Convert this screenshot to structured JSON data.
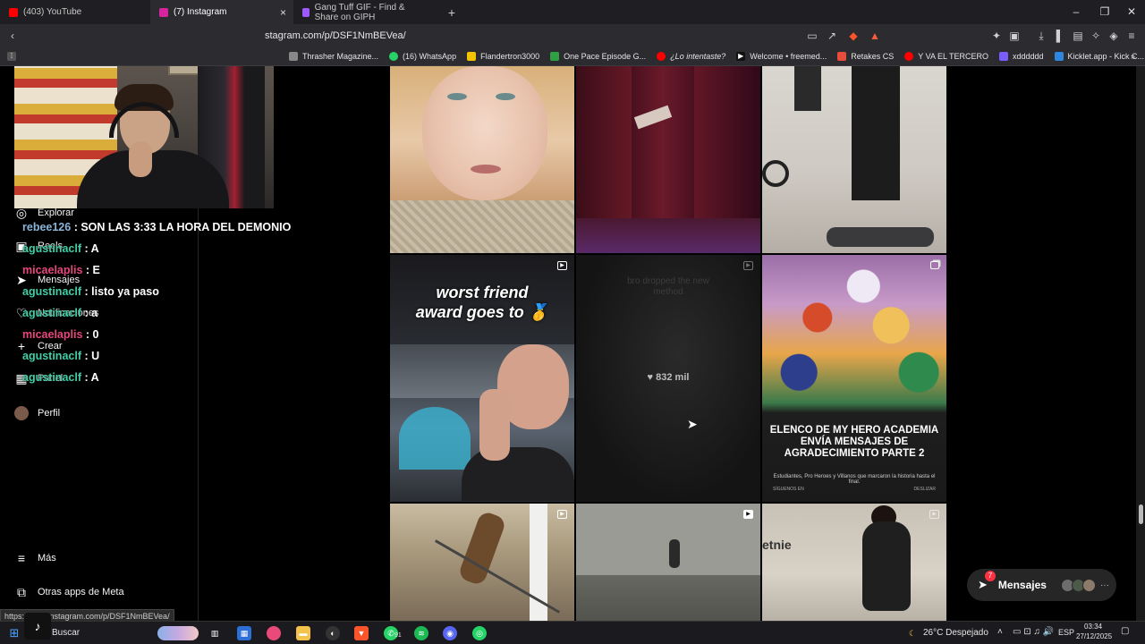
{
  "tabs": [
    {
      "title": "(403) YouTube",
      "color": "#ff0000"
    },
    {
      "title": "(7) Instagram",
      "color": "#d6249f"
    },
    {
      "title": "Gang Tuff GIF - Find & Share on GIPH",
      "color": "#9b59ff"
    }
  ],
  "address": {
    "url": "stagram.com/p/DSF1NmBEVea/"
  },
  "bookmarks": [
    {
      "label": "Thrasher Magazine...",
      "color": "#fff"
    },
    {
      "label": "(16) WhatsApp",
      "color": "#25d366"
    },
    {
      "label": "Flandertron3000",
      "color": "#f3c300"
    },
    {
      "label": "One Pace Episode G...",
      "color": "#2ea043"
    },
    {
      "label": "¿Lo intentaste?",
      "color": "#ff0000"
    },
    {
      "label": "Welcome • freemed...",
      "color": "#111"
    },
    {
      "label": "Retakes CS",
      "color": "#e74c3c"
    },
    {
      "label": "Y VA EL TERCERO",
      "color": "#ff0000"
    },
    {
      "label": "xdddddd",
      "color": "#7b5cff"
    },
    {
      "label": "Kicklet.app - Kick C...",
      "color": "#2e86de"
    }
  ],
  "sidebar": {
    "explore": "Explorar",
    "reels": "Reels",
    "messages": "Mensajes",
    "notifications": "Notificaciones",
    "create": "Crear",
    "panel": "Panel",
    "profile": "Perfil",
    "more": "Más",
    "meta_apps": "Otras apps de Meta"
  },
  "chat": [
    {
      "user": "rebee126",
      "text": ": SON LAS 3:33 LA HORA DEL DEMONIO",
      "style": "c"
    },
    {
      "user": "agustinaclf",
      "text": ": A",
      "style": "a"
    },
    {
      "user": "micaelaplis",
      "text": ": E",
      "style": "b"
    },
    {
      "user": "agustinaclf",
      "text": ": listo ya paso",
      "style": "a"
    },
    {
      "user": "agustinaclf",
      "text": ": a",
      "style": "a"
    },
    {
      "user": "micaelaplis",
      "text": ": 0",
      "style": "b"
    },
    {
      "user": "agustinaclf",
      "text": ": U",
      "style": "a"
    },
    {
      "user": "agustinaclf",
      "text": ": A",
      "style": "a"
    }
  ],
  "grid": {
    "post4_caption_line1": "worst friend",
    "post4_caption_line2": "award goes to 🥇",
    "post5_ghost1": "bro dropped the new",
    "post5_ghost2": "method",
    "post5_likes": "832 mil",
    "post6_headline": "ELENCO DE MY HERO ACADEMIA ENVÍA MENSAJES DE AGRADECIMIENTO PARTE 2",
    "post6_sub": "Estudiantes, Pro Heroes y Villanos que marcaron la historia hasta el final.",
    "post6_follow": "SÍGUENOS EN",
    "post6_swipe": "DESLIZAR",
    "post9_brand": "etnie"
  },
  "messages_pill": {
    "label": "Mensajes",
    "badge": "7",
    "more": "···"
  },
  "status_url": "https://www.instagram.com/p/DSF1NmBEVea/",
  "taskbar": {
    "search": "Buscar",
    "whatsapp_badge": "91",
    "weather": "26°C  Despejado",
    "lang": "ESP",
    "time": "03:34",
    "date": "27/12/2025"
  }
}
